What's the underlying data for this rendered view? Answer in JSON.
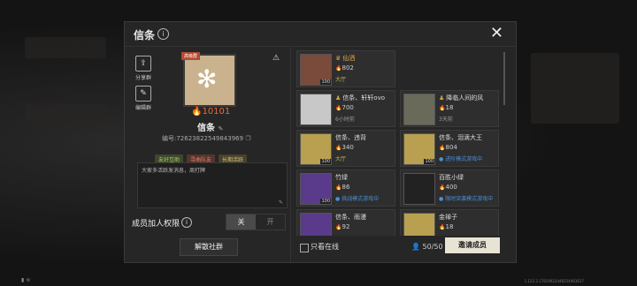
{
  "dialog": {
    "title": "信条",
    "close_label": "✕",
    "share_label": "分享群",
    "edit_label": "编辑群",
    "level_tag": "高级群",
    "heat": "10101",
    "name": "信条",
    "id_text": "编号:72623822549843969",
    "tags": [
      {
        "text": "友好互助",
        "color": "#6b8e3a"
      },
      {
        "text": "寻曲队友",
        "color": "#b5533a"
      },
      {
        "text": "长期活跃",
        "color": "#8a7a3a"
      }
    ],
    "notice": "大家多活跃发消息，周打牌",
    "perm_label": "成员加人权限",
    "perm_off": "关",
    "perm_on": "开",
    "disband_label": "解散社群"
  },
  "members": [
    {
      "name": "仙洒",
      "hot": "802",
      "status": "大厅",
      "status_color": "#c5b04a",
      "name_color": "#e0a64a",
      "ava_color": "#7a4a3a",
      "badge": "100",
      "crown": "♛"
    },
    {
      "name": "信条、轩轩ovo",
      "hot": "700",
      "status": "6小时前",
      "status_color": "#999999",
      "name_color": "#dddddd",
      "ava_color": "#c8c8c8",
      "badge": "",
      "crown": "♟"
    },
    {
      "name": "降临人间的风",
      "hot": "18",
      "status": "3天前",
      "status_color": "#999999",
      "name_color": "#dddddd",
      "ava_color": "#6a6a5a",
      "badge": "",
      "crown": "♟"
    },
    {
      "name": "信条、违背",
      "hot": "340",
      "status": "大厅",
      "status_color": "#c5b04a",
      "name_color": "#dddddd",
      "ava_color": "#b8a050",
      "badge": "100",
      "crown": ""
    },
    {
      "name": "信条、泪滴大王",
      "hot": "804",
      "status": "● 进阶模式游戏中",
      "status_color": "#4a8fd8",
      "name_color": "#dddddd",
      "ava_color": "#b8a050",
      "badge": "100",
      "crown": ""
    },
    {
      "name": "竹绿",
      "hot": "86",
      "status": "● 挑战模式游戏中",
      "status_color": "#4a8fd8",
      "name_color": "#dddddd",
      "ava_color": "#5a3a8a",
      "badge": "100",
      "crown": ""
    },
    {
      "name": "百胜小绿",
      "hot": "400",
      "status": "● 限时突袭模式游戏中",
      "status_color": "#4a8fd8",
      "name_color": "#dddddd",
      "ava_color": "#222222",
      "badge": "",
      "crown": ""
    },
    {
      "name": "信条、雨漫",
      "hot": "92",
      "status": "",
      "status_color": "#999999",
      "name_color": "#dddddd",
      "ava_color": "#5a3a8a",
      "badge": "",
      "crown": ""
    },
    {
      "name": "金禅子",
      "hot": "18",
      "status": "",
      "status_color": "#999999",
      "name_color": "#dddddd",
      "ava_color": "#b8a050",
      "badge": "",
      "crown": ""
    }
  ],
  "footer": {
    "online_label": "只看在线",
    "count": "50/50",
    "invite_label": "邀请成员"
  },
  "statusbar": {
    "version": "1.122.3.17819922448254983617"
  }
}
